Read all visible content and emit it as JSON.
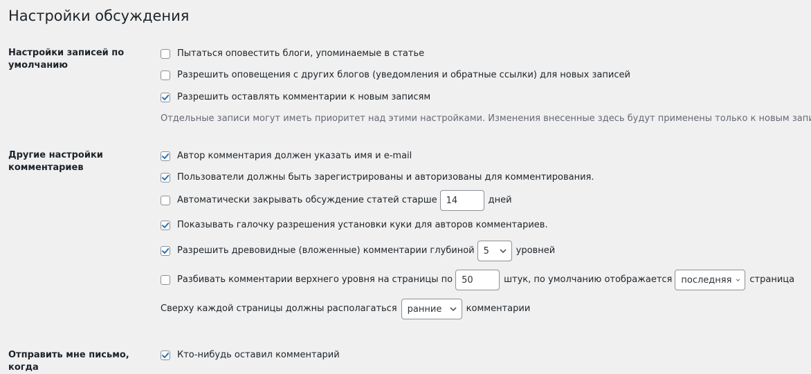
{
  "page": {
    "title": "Настройки обсуждения"
  },
  "sections": {
    "defaults": {
      "label": "Настройки записей по умолчанию",
      "pingbacks": "Пытаться оповестить блоги, упоминаемые в статье",
      "notifications": "Разрешить оповещения с других блогов (уведомления и обратные ссылки) для новых записей",
      "allow_comments": "Разрешить оставлять комментарии к новым записям",
      "description": "Отдельные записи могут иметь приоритет над этими настройками. Изменения внесенные здесь будут применены только к новым записям."
    },
    "other": {
      "label": "Другие настройки комментариев",
      "require_name_email": "Автор комментария должен указать имя и e-mail",
      "registration": "Пользователи должны быть зарегистрированы и авторизованы для комментирования.",
      "close_old_before": "Автоматически закрывать обсуждение статей старше",
      "close_days_value": "14",
      "close_days_after": "дней",
      "cookies_opt_in": "Показывать галочку разрешения установки куки для авторов комментариев.",
      "threaded_before": "Разрешить древовидные (вложенные) комментарии глубиной",
      "threaded_depth": "5",
      "threaded_after": "уровней",
      "paginate_before": "Разбивать комментарии верхнего уровня на страницы по",
      "per_page_value": "50",
      "paginate_middle": "штук, по умолчанию отображается",
      "default_page": "последняя",
      "paginate_after": "страница",
      "order_before": "Сверху каждой страницы должны располагаться",
      "order_value": "ранние",
      "order_after": "комментарии"
    },
    "email": {
      "label": "Отправить мне письмо, когда",
      "anyone_posts": "Кто-нибудь оставил комментарий"
    }
  },
  "checkbox_states": {
    "pingbacks": false,
    "notifications": false,
    "allow_comments": true,
    "require_name_email": true,
    "registration": true,
    "close_old": false,
    "cookies_opt_in": true,
    "threaded": true,
    "paginate": false,
    "anyone_posts": true
  },
  "colors": {
    "checkmark": "#2271b1",
    "text": "#1d2327",
    "muted": "#646970",
    "background": "#f0f0f1"
  },
  "icons": {
    "checkbox_checked": "checkmark-icon",
    "select": "chevron-down-icon"
  }
}
